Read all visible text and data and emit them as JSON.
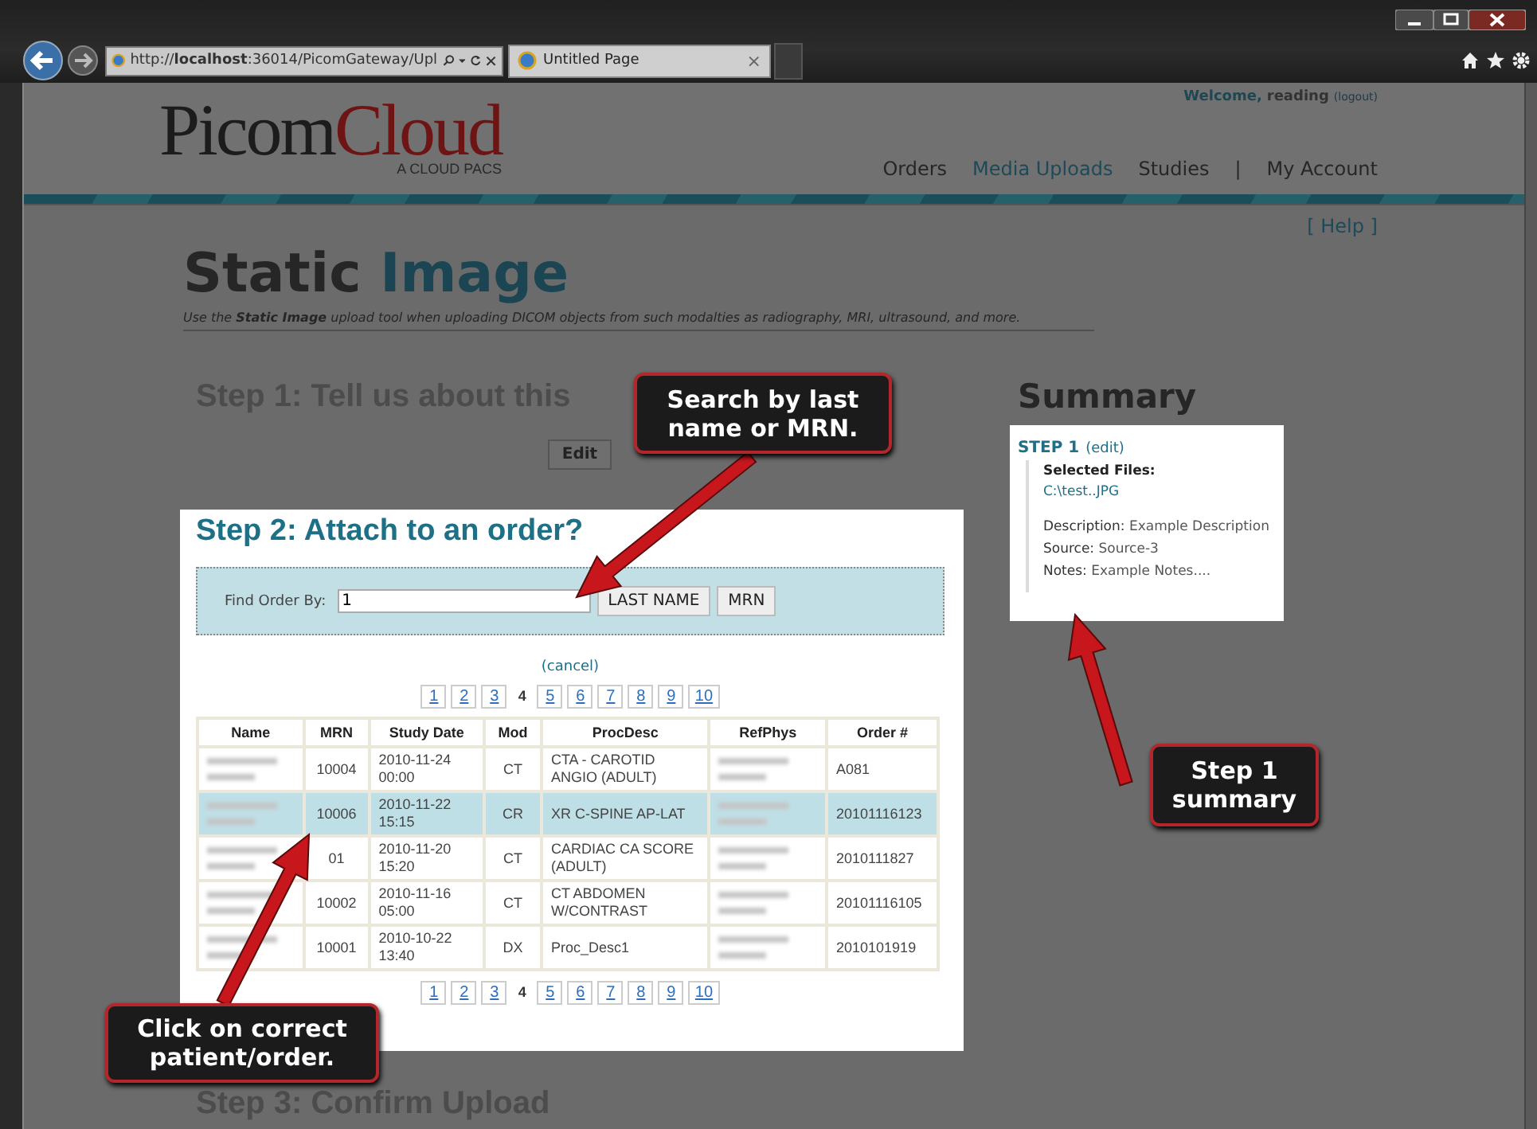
{
  "browser": {
    "address": "http://**localhost**:36014/PicomGateway/Upl",
    "tab": "Untitled Page",
    "tab_close": "×"
  },
  "header": {
    "logo_dark": "Picom",
    "logo_accent": "Cloud",
    "tagline": "A CLOUD PACS",
    "welcome": "Welcome,",
    "user": "reading",
    "logout": "(logout)",
    "nav": [
      {
        "kind": "link",
        "label": "Orders",
        "selected": false
      },
      {
        "kind": "link",
        "label": "Media Uploads",
        "selected": true
      },
      {
        "kind": "link",
        "label": "Studies",
        "selected": false
      },
      {
        "kind": "separator",
        "label": "|"
      },
      {
        "kind": "link",
        "label": "My Account",
        "selected": false
      }
    ]
  },
  "help": "[ Help ]",
  "title_dark": "Static",
  "title_accent": "Image",
  "subtitle": "Use the **Static Image** upload tool when uploading DICOM objects from such modalties as radiography, MRI, ultrasound, and more.",
  "step1": {
    "heading": "Step 1: Tell us about this",
    "button": "Edit"
  },
  "step2": {
    "heading": "Step 2: Attach to an order?",
    "find_label": "Find Order By:",
    "find_value": "1",
    "buttons": [
      "LAST NAME",
      "MRN"
    ],
    "cancel": "(cancel)",
    "pages_top": [
      {
        "label": "1",
        "selected": false
      },
      {
        "label": "2",
        "selected": false
      },
      {
        "label": "3",
        "selected": false
      },
      {
        "label": "4",
        "selected": true
      },
      {
        "label": "5",
        "selected": false
      },
      {
        "label": "6",
        "selected": false
      },
      {
        "label": "7",
        "selected": false
      },
      {
        "label": "8",
        "selected": false
      },
      {
        "label": "9",
        "selected": false
      },
      {
        "label": "10",
        "selected": false
      }
    ],
    "pages_bottom": [
      {
        "label": "1",
        "selected": false
      },
      {
        "label": "2",
        "selected": false
      },
      {
        "label": "3",
        "selected": false
      },
      {
        "label": "4",
        "selected": true
      },
      {
        "label": "5",
        "selected": false
      },
      {
        "label": "6",
        "selected": false
      },
      {
        "label": "7",
        "selected": false
      },
      {
        "label": "8",
        "selected": false
      },
      {
        "label": "9",
        "selected": false
      },
      {
        "label": "10",
        "selected": false
      }
    ],
    "columns": [
      "Name",
      "MRN",
      "Study Date",
      "Mod",
      "ProcDesc",
      "RefPhys",
      "Order #"
    ],
    "rows": [
      {
        "name_blurred": true,
        "mrn": "10004",
        "date": "2010-11-24 00:00",
        "mod": "CT",
        "proc": "CTA - CAROTID ANGIO (ADULT)",
        "refphys_blurred": true,
        "order": "A081",
        "selected": false
      },
      {
        "name_blurred": true,
        "mrn": "10006",
        "date": "2010-11-22 15:15",
        "mod": "CR",
        "proc": "XR C-SPINE AP-LAT",
        "refphys_blurred": true,
        "order": "20101116123",
        "selected": true
      },
      {
        "name_blurred": true,
        "mrn": "01",
        "date": "2010-11-20 15:20",
        "mod": "CT",
        "proc": "CARDIAC CA SCORE (ADULT)",
        "refphys_blurred": true,
        "order": "2010111827",
        "selected": false
      },
      {
        "name_blurred": true,
        "mrn": "10002",
        "date": "2010-11-16 05:00",
        "mod": "CT",
        "proc": "CT ABDOMEN W/CONTRAST",
        "refphys_blurred": true,
        "order": "20101116105",
        "selected": false
      },
      {
        "name_blurred": true,
        "mrn": "10001",
        "date": "2010-10-22 13:40",
        "mod": "DX",
        "proc": "Proc_Desc1",
        "refphys_blurred": true,
        "order": "2010101919",
        "selected": false
      }
    ]
  },
  "step3": {
    "heading": "Step 3: Confirm Upload"
  },
  "summary": {
    "heading": "Summary",
    "step": "STEP 1",
    "edit": "(edit)",
    "files_label": "Selected Files:",
    "file": "C:\\test..JPG",
    "details": [
      {
        "label": "Description:",
        "value": "Example Description"
      },
      {
        "label": "Source:",
        "value": "Source-3"
      },
      {
        "label": "Notes:",
        "value": "Example Notes...."
      }
    ]
  },
  "callouts": [
    {
      "text": "Search by last name or MRN."
    },
    {
      "text": "Step 1 summary"
    },
    {
      "text": "Click on correct patient/order."
    }
  ]
}
